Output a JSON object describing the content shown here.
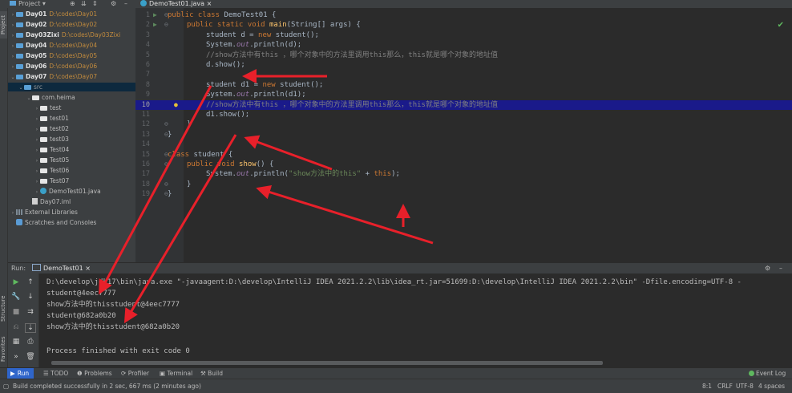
{
  "topbar": {
    "project_label": "Project",
    "tab_file": "DemoTest01.java"
  },
  "side_labels": {
    "project": "Project",
    "structure": "Structure",
    "favorites": "Favorites"
  },
  "tree": [
    {
      "name": "Day01",
      "path": "D:\\codes\\Day01"
    },
    {
      "name": "Day02",
      "path": "D:\\codes\\Day02"
    },
    {
      "name": "Day03Zixi",
      "path": "D:\\codes\\Day03Zixi"
    },
    {
      "name": "Day04",
      "path": "D:\\codes\\Day04"
    },
    {
      "name": "Day05",
      "path": "D:\\codes\\Day05"
    },
    {
      "name": "Day06",
      "path": "D:\\codes\\Day06"
    },
    {
      "name": "Day07",
      "path": "D:\\codes\\Day07"
    }
  ],
  "tree_src": "src",
  "tree_pkg": "com.heima",
  "tree_sub": [
    "test",
    "test01",
    "test02",
    "test03",
    "Test04",
    "Test05",
    "Test06",
    "Test07"
  ],
  "tree_file": "DemoTest01.java",
  "tree_iml": "Day07.iml",
  "tree_libs": "External Libraries",
  "tree_scratch": "Scratches and Consoles",
  "code": {
    "l1a": "public class ",
    "l1b": "DemoTest01 {",
    "l2a": "public static void ",
    "l2b": "main",
    "l2c": "(String[] args) {",
    "l3a": "student d = ",
    "l3b": "new ",
    "l3c": "student();",
    "l4a": "System.",
    "l4b": "out",
    "l4c": ".println(d);",
    "l5": "//show方法中有this ，哪个对象中的方法里调用this那么，this就是哪个对象的地址值",
    "l6": "d.show();",
    "l8a": "student d1 = ",
    "l8b": "new ",
    "l8c": "student();",
    "l9a": "System.",
    "l9b": "out",
    "l9c": ".println(d1);",
    "l10": "//show方法中有this ，哪个对象中的方法里调用this那么，this就是哪个对象的地址值",
    "l11": "d1.show();",
    "l12": "}",
    "l13": "}",
    "l15a": "class ",
    "l15b": "student {",
    "l16a": "public void ",
    "l16b": "show",
    "l16c": "() {",
    "l17a": "System.",
    "l17b": "out",
    "l17c": ".println(",
    "l17d": "\"show方法中的this\"",
    "l17e": " + ",
    "l17f": "this",
    "l17g": ");",
    "l18": "}",
    "l19": "}"
  },
  "line_numbers": [
    "1",
    "2",
    "3",
    "4",
    "5",
    "6",
    "7",
    "8",
    "9",
    "10",
    "11",
    "12",
    "13",
    "14",
    "15",
    "16",
    "17",
    "18",
    "19"
  ],
  "run": {
    "label": "Run:",
    "tab": "DemoTest01"
  },
  "console": [
    "D:\\develop\\jdk17\\bin\\java.exe \"-javaagent:D:\\develop\\IntelliJ IDEA 2021.2.2\\lib\\idea_rt.jar=51699:D:\\develop\\IntelliJ IDEA 2021.2.2\\bin\" -Dfile.encoding=UTF-8 -",
    "student@4eec7777",
    "show方法中的thisstudent@4eec7777",
    "student@682a0b20",
    "show方法中的thisstudent@682a0b20",
    "",
    "Process finished with exit code 0"
  ],
  "bottombar": {
    "run": "Run",
    "todo": "TODO",
    "problems": "Problems",
    "profiler": "Profiler",
    "terminal": "Terminal",
    "build": "Build",
    "event_log": "Event Log"
  },
  "status": {
    "message": "Build completed successfully in 2 sec, 667 ms (2 minutes ago)",
    "position": "8:1",
    "line_sep": "CRLF",
    "encoding": "UTF-8",
    "indent": "4 spaces"
  },
  "colors": {
    "annotation_arrow": "#e8202a",
    "highlight_line": "#1a1a8a",
    "run_tab": "#2f65ca"
  }
}
